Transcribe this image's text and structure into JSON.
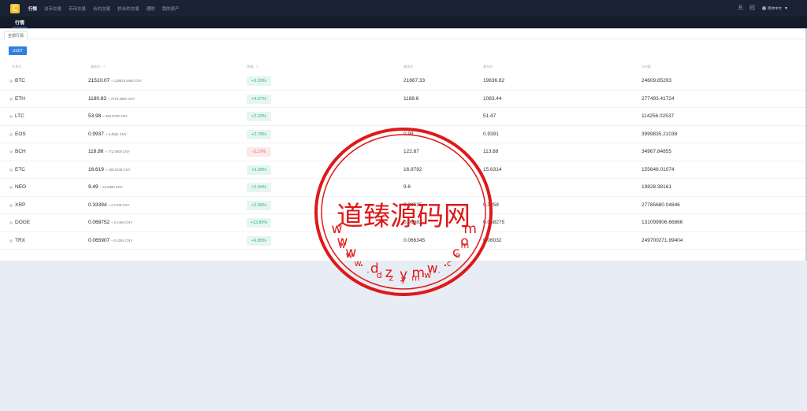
{
  "nav": {
    "items": [
      "行情",
      "法币交易",
      "币币交易",
      "合约交易",
      "秒合约交易",
      "理财",
      "我的资产"
    ],
    "active_index": 0,
    "language": "简体中文"
  },
  "subnav": {
    "tab": "行情"
  },
  "category_tab": "全部行情",
  "quote_button": "USDT",
  "table": {
    "headers": [
      "交易对",
      "最新价",
      "涨幅",
      "最高价",
      "最低价",
      "24H量"
    ],
    "rows": [
      {
        "symbol": "BTC",
        "price": "21510.07",
        "cny": "≈ 139815.4550 CNY",
        "change": "+3.29%",
        "direction": "up",
        "high": "21667.33",
        "low": "19836.82",
        "volume": "24609.85293"
      },
      {
        "symbol": "ETH",
        "price": "1180.83",
        "cny": "≈ 7675.3950 CNY",
        "change": "+4.07%",
        "direction": "up",
        "high": "1188.6",
        "low": "1083.44",
        "volume": "277493.41724"
      },
      {
        "symbol": "LTC",
        "price": "53.98",
        "cny": "≈ 350.8700 CNY",
        "change": "+2.20%",
        "direction": "up",
        "high": "",
        "low": "51.47",
        "volume": "114256.02537"
      },
      {
        "symbol": "EOS",
        "price": "0.9937",
        "cny": "≈ 6.4591 CNY",
        "change": "+2.78%",
        "direction": "up",
        "high": "0.99",
        "low": "0.9391",
        "volume": "3999835.21038"
      },
      {
        "symbol": "BCH",
        "price": "118.86",
        "cny": "≈ 772.5900 CNY",
        "change": "-2.17%",
        "direction": "down",
        "high": "122.87",
        "low": "113.88",
        "volume": "34967.84855"
      },
      {
        "symbol": "ETC",
        "price": "16.619",
        "cny": "≈ 108.0235 CNY",
        "change": "+3.28%",
        "direction": "up",
        "high": "16.9792",
        "low": "15.6314",
        "volume": "155648.01074"
      },
      {
        "symbol": "NEO",
        "price": "9.49",
        "cny": "≈ 61.6850 CNY",
        "change": "+2.04%",
        "direction": "up",
        "high": "9.6",
        "low": "",
        "volume": "19828.38161"
      },
      {
        "symbol": "XRP",
        "price": "0.33394",
        "cny": "≈ 2.1706 CNY",
        "change": "+2.55%",
        "direction": "up",
        "high": "0.33635",
        "low": "0.3258",
        "volume": "27785680.04846"
      },
      {
        "symbol": "DOGE",
        "price": "0.068752",
        "cny": "≈ 0.4469 CNY",
        "change": "+13.89%",
        "direction": "up",
        "high": "0.06882",
        "low": "0.058275",
        "volume": "131099906.66866"
      },
      {
        "symbol": "TRX",
        "price": "0.065907",
        "cny": "≈ 0.4284 CNY",
        "change": "+6.85%",
        "direction": "up",
        "high": "0.066345",
        "low": "0.06032",
        "volume": "249700271.99404"
      }
    ]
  },
  "watermark": {
    "center_text": "道臻源码网",
    "top_text": "www.dzymw.com",
    "bottom_text": "www.dzymw.com",
    "color": "#e01818"
  },
  "colors": {
    "up": "#2fb37a",
    "down": "#e5535b",
    "accent": "#2f7ee0",
    "nav_bg": "#1a2233"
  }
}
